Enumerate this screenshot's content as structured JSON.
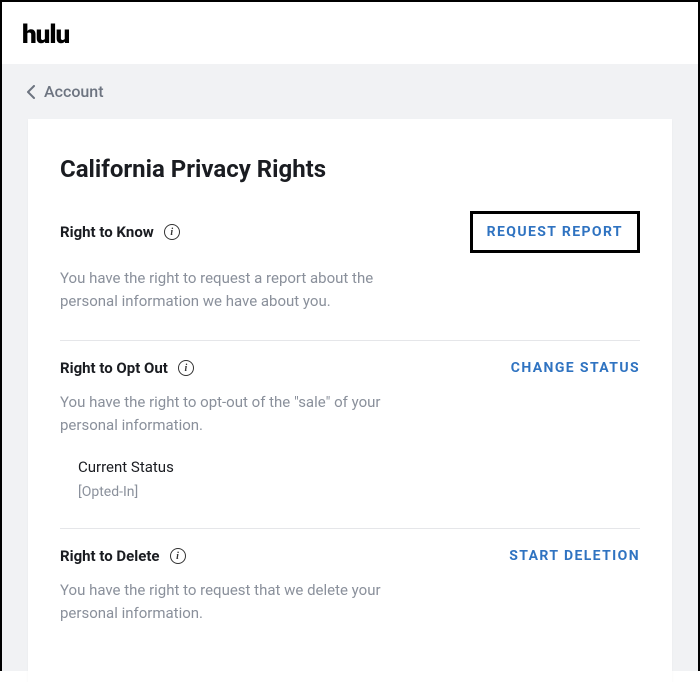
{
  "brand": "hulu",
  "breadcrumb": {
    "label": "Account"
  },
  "page": {
    "title": "California Privacy Rights"
  },
  "sections": {
    "know": {
      "title": "Right to Know",
      "action": "REQUEST REPORT",
      "desc": "You have the right to request a report about the personal information we have about you."
    },
    "optout": {
      "title": "Right to Opt Out",
      "action": "CHANGE STATUS",
      "desc": "You have the right to opt-out of the \"sale\" of your personal information.",
      "status_label": "Current Status",
      "status_value": "[Opted-In]"
    },
    "delete": {
      "title": "Right to Delete",
      "action": "START DELETION",
      "desc": "You have the right to request that we delete your personal information."
    }
  }
}
